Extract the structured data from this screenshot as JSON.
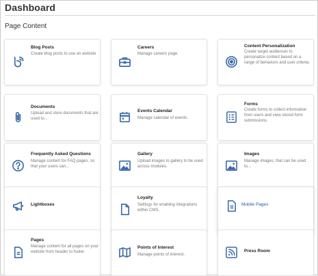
{
  "page": {
    "title": "Dashboard",
    "section_title": "Page Content"
  },
  "colors": {
    "icon": "#3a6aa5",
    "text": "#333333",
    "muted": "#777777",
    "link": "#1f5faa"
  },
  "cards": [
    {
      "title": "Blog Posts",
      "desc": "Create blog posts to use on website",
      "icon": "blog-icon"
    },
    {
      "title": "Careers",
      "desc": "Manage careers page.",
      "icon": "briefcase-icon"
    },
    {
      "title": "Content Personalization",
      "desc": "Create target audiences to personalize content based on a range of behaviors and user criteria.",
      "icon": "target-icon"
    },
    {
      "title": "Documents",
      "desc": "Upload and store documents that are used to...",
      "icon": "paperclip-icon"
    },
    {
      "title": "Events Calendar",
      "desc": "Manage calendar of events.",
      "icon": "calendar-icon"
    },
    {
      "title": "Forms",
      "desc": "Create forms to collect information from users and view stored form submissions.",
      "icon": "form-icon"
    },
    {
      "title": "Frequently Asked Questions",
      "desc": "Manage content for FAQ pages, so that your users can...",
      "icon": "question-icon"
    },
    {
      "title": "Gallery",
      "desc": "Upload images to gallery to be used across modules.",
      "icon": "image-icon"
    },
    {
      "title": "Images",
      "desc": "Manage images, that can be used to...",
      "icon": "image-icon"
    },
    {
      "title": "Lightboxes",
      "desc": "",
      "icon": "megaphone-icon"
    },
    {
      "title": "Loyalty",
      "desc": "Settings for enabling integrations within CMS.",
      "icon": "document-icon"
    },
    {
      "title": "Mobile Pages",
      "desc": "",
      "icon": "mobile-page-icon"
    },
    {
      "title": "Pages",
      "desc": "Manage content for all pages on your website from header to footer.",
      "icon": "page-icon"
    },
    {
      "title": "Points of Interest",
      "desc": "Manage points of interest.",
      "icon": "map-icon"
    },
    {
      "title": "Press Room",
      "desc": "",
      "icon": "rss-icon"
    }
  ]
}
